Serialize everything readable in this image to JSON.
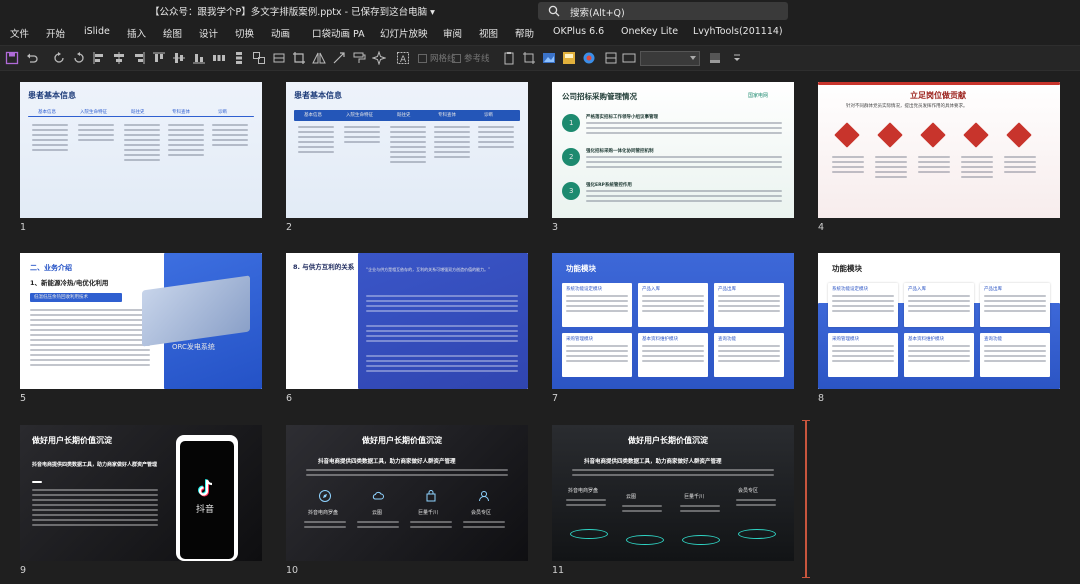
{
  "titlebar": {
    "doc_title": "【公众号：跟我学个P】多文字排版案例.pptx - 已保存到这台电脑 ▾",
    "search_placeholder": "搜索(Alt+Q)"
  },
  "menu": [
    "文件",
    "开始",
    "iSlide",
    "插入",
    "绘图",
    "设计",
    "切换",
    "动画",
    "口袋动画 PA",
    "幻灯片放映",
    "审阅",
    "视图",
    "帮助",
    "OKPlus 6.6",
    "OneKey Lite",
    "LvyhTools(201114)"
  ],
  "toolbar": {
    "gridlines_label": "网格线",
    "guides_label": "参考线"
  },
  "slides": [
    {
      "number": "1",
      "title": "患者基本信息",
      "headers": [
        "基本信息",
        "入院生命特征",
        "既往史",
        "专科查体",
        "诊断"
      ],
      "theme": "light-blue"
    },
    {
      "number": "2",
      "title": "患者基本信息",
      "headers": [
        "基本信息",
        "入院生命特征",
        "既往史",
        "专科查体",
        "诊断"
      ],
      "theme": "light-blue-dark-header"
    },
    {
      "number": "3",
      "title": "公司招标采购管理情况",
      "brand": "国家电网",
      "items": [
        "严格落实招标工作领导小组议事管理",
        "强化招标采购一体化协同管控机制",
        "强化ERP系统管控作用"
      ],
      "steps": [
        "1",
        "2",
        "3"
      ]
    },
    {
      "number": "4",
      "title": "立足岗位做贡献",
      "subtitle": "针对不同群体党员实际情况，提出党员发挥作用的具体要求。"
    },
    {
      "number": "5",
      "title": "二、业务介绍",
      "subtitle": "1、新能源冷热/电优化利用",
      "tag": "低温低压余热回收利用技术",
      "image_caption": "ORC发电系统"
    },
    {
      "number": "6",
      "title": "8. 与供方互利的关系",
      "quote": "“企业与供方是相互依存的，互利的关系可增强双方创造价值的能力。”"
    },
    {
      "number": "7",
      "title": "功能模块",
      "modules": [
        "系统功能设定模块",
        "产品入库",
        "产品出库",
        "采购管理模块",
        "基本资料维护模块",
        "查询功能"
      ]
    },
    {
      "number": "8",
      "title": "功能模块",
      "modules": [
        "系统功能设定模块",
        "产品入库",
        "产品出库",
        "采购管理模块",
        "基本资料维护模块",
        "查询功能"
      ]
    },
    {
      "number": "9",
      "title": "做好用户长期价值沉淀",
      "subtitle": "抖音电商提供四类数据工具，助力商家做好人群资产管理",
      "phone_label": "抖音"
    },
    {
      "number": "10",
      "title": "做好用户长期价值沉淀",
      "subtitle": "抖音电商提供四类数据工具，助力商家做好人群资产管理",
      "tools": [
        "抖音电商罗盘",
        "云图",
        "巨量千川",
        "会员专区"
      ]
    },
    {
      "number": "11",
      "title": "做好用户长期价值沉淀",
      "subtitle": "抖音电商提供四类数据工具，助力商家做好人群资产管理",
      "tools": [
        "抖音电商罗盘",
        "云图",
        "巨量千川",
        "会员专区"
      ]
    }
  ],
  "colors": {
    "accent_blue": "#2f5fd0",
    "deep_blue": "#1e3f9e",
    "teal": "#1d8a6f",
    "red": "#c8342c",
    "insert_marker": "#c8553d"
  }
}
